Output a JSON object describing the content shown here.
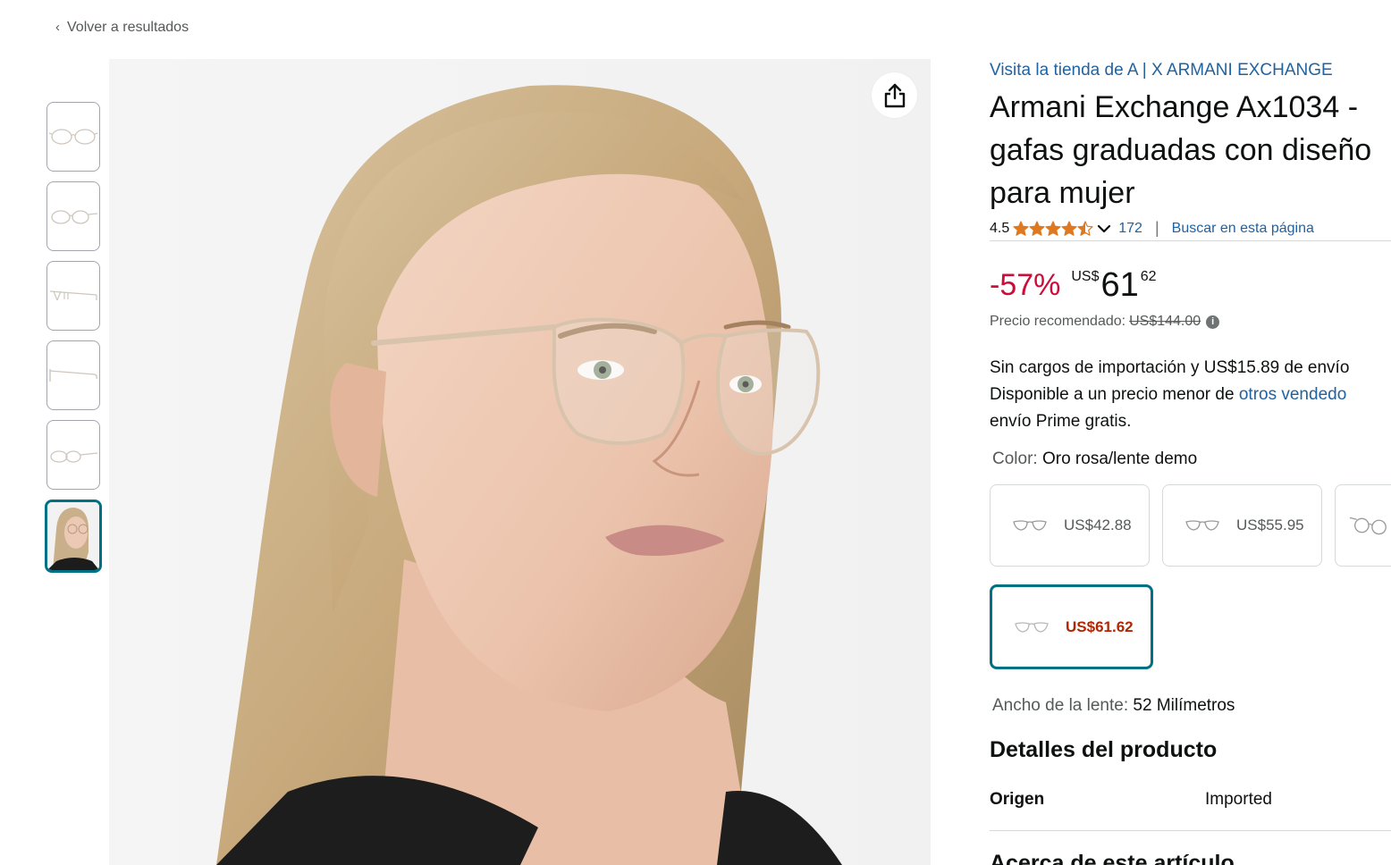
{
  "nav": {
    "back_label": "Volver a resultados"
  },
  "gallery": {
    "thumbnail_count": 6,
    "selected_index": 5,
    "share_icon": "share-icon"
  },
  "product": {
    "store_link": "Visita la tienda de A | X ARMANI EXCHANGE",
    "title_lines": [
      "Armani Exchange Ax1034 -",
      "gafas graduadas con diseño",
      "para mujer"
    ],
    "rating": {
      "value": "4.5",
      "stars": 4.5,
      "count": "172",
      "search_link": "Buscar en esta página"
    },
    "price": {
      "discount": "-57%",
      "currency": "US$",
      "whole": "61",
      "fraction": "62",
      "list_label": "Precio recomendado:",
      "list_price": "US$144.00"
    },
    "shipping": {
      "line1": "Sin cargos de importación y US$15.89 de envío",
      "line2_prefix": "Disponible a un precio menor de ",
      "line2_link": "otros vendedo",
      "line3": "envío Prime gratis."
    },
    "color": {
      "label": "Color:",
      "value": "Oro rosa/lente demo",
      "options": [
        {
          "price": "US$42.88",
          "selected": false
        },
        {
          "price": "US$55.95",
          "selected": false
        },
        {
          "price": "",
          "selected": false
        },
        {
          "price": "US$61.62",
          "selected": true
        }
      ]
    },
    "lens_width": {
      "label": "Ancho de la lente:",
      "value": "52 Milímetros"
    },
    "details": {
      "heading": "Detalles del producto",
      "rows": [
        {
          "key": "Origen",
          "value": "Imported"
        }
      ]
    },
    "about_heading": "Acerca de este artículo"
  },
  "colors": {
    "link": "#2162a1",
    "discount": "#cc0c39",
    "selected_border": "#007185",
    "selected_price": "#b12704",
    "star": "#de7921"
  }
}
